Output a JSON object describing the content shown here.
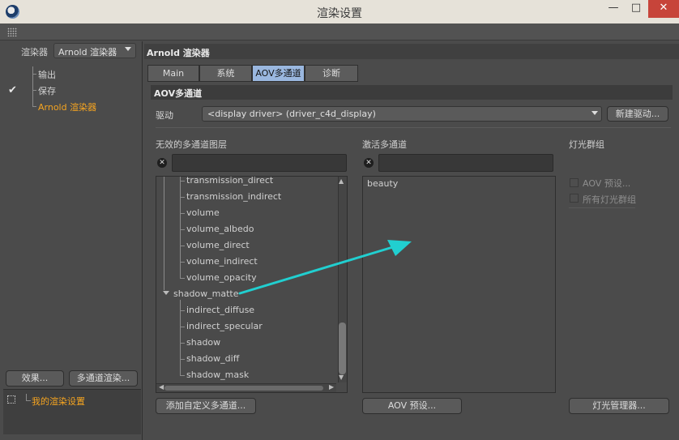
{
  "window": {
    "title": "渲染设置",
    "min_symbol": "—",
    "max_symbol": "□",
    "close_symbol": "✕"
  },
  "sidebar": {
    "renderer_label": "渲染器",
    "renderer_value": "Arnold 渲染器",
    "tree": [
      "输出",
      "保存",
      "Arnold 渲染器"
    ],
    "effects_button": "效果...",
    "multipass_button": "多通道渲染...",
    "preset_label": "我的渲染设置"
  },
  "main": {
    "header": "Arnold 渲染器",
    "tabs": [
      "Main",
      "系统",
      "AOV多通道",
      "诊断"
    ],
    "active_tab": "AOV多通道",
    "section_header": "AOV多通道",
    "driver_label": "驱动",
    "driver_value": "<display driver> (driver_c4d_display)",
    "new_driver_button": "新建驱动...",
    "inactive_header": "无效的多通道图层",
    "active_header": "激活多通道",
    "light_groups_header": "灯光群组",
    "inactive_list": [
      "transmission_direct",
      "transmission_indirect",
      "volume",
      "volume_albedo",
      "volume_direct",
      "volume_indirect",
      "volume_opacity",
      "shadow_matte",
      "indirect_diffuse",
      "indirect_specular",
      "shadow",
      "shadow_diff",
      "shadow_mask"
    ],
    "active_list": [
      "beauty"
    ],
    "light_options": [
      "AOV 预设...",
      "所有灯光群组"
    ],
    "add_custom_button": "添加自定义多通道...",
    "aov_preset_button": "AOV 预设...",
    "light_manager_button": "灯光管理器..."
  },
  "colors": {
    "accent_orange": "#f5a420",
    "active_tab": "#9ab7df",
    "arrow_cyan": "#21cfd0"
  }
}
